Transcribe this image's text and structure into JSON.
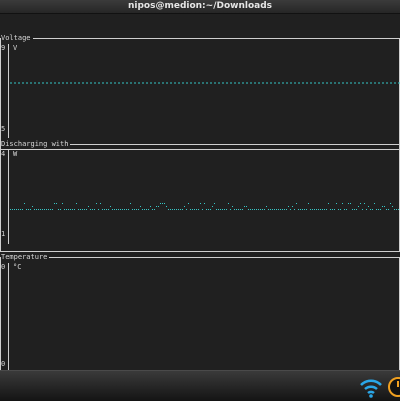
{
  "window": {
    "title": "nipos@medion:~/Downloads"
  },
  "panels": [
    {
      "title": "Voltage",
      "unit": "V",
      "tick_top": "9",
      "tick_bottom": "5"
    },
    {
      "title": "Discharging with",
      "unit": "W",
      "tick_top": "4",
      "tick_bottom": "1"
    },
    {
      "title": "Temperature",
      "unit": "°C",
      "tick_top": "0",
      "tick_bottom": "0"
    }
  ],
  "tray": {
    "icons": [
      "wifi-icon",
      "power-icon"
    ]
  },
  "colors": {
    "trace": "#35c6c6",
    "frame": "#cfcfcf",
    "background": "#202020"
  }
}
